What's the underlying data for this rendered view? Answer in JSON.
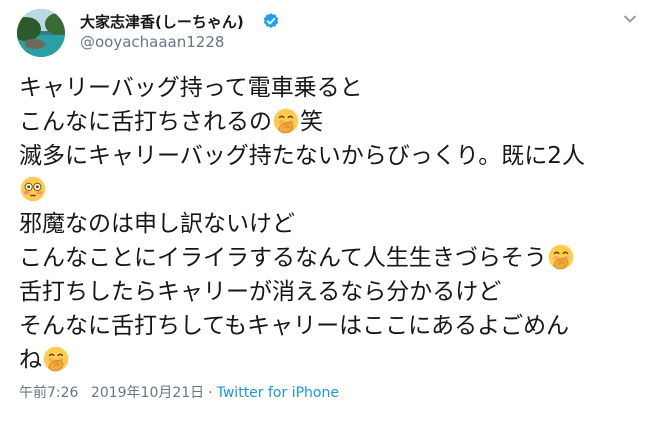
{
  "user": {
    "display_name": "大家志津香(しーちゃん)",
    "handle": "@ooyachaaan1228"
  },
  "tweet": {
    "lines": [
      [
        "キャリーバッグ持って電車乗ると"
      ],
      [
        "こんなに舌打ちされるの",
        "#hand-over-mouth",
        "笑"
      ],
      [
        "滅多にキャリーバッグ持たないからびっくり。既に2人"
      ],
      [
        "#flushed"
      ],
      [
        "邪魔なのは申し訳ないけど"
      ],
      [
        "こんなことにイライラするなんて人生生きづらそう",
        "#hand-over-mouth"
      ],
      [
        "舌打ちしたらキャリーが消えるなら分かるけど"
      ],
      [
        "そんなに舌打ちしてもキャリーはここにあるよごめん"
      ],
      [
        "ね",
        "#hand-over-mouth"
      ]
    ],
    "emoji_icons": [
      "hand-over-mouth-emoji",
      "flushed-face-emoji"
    ]
  },
  "meta": {
    "time": "午前7:26",
    "separator": "·",
    "date": "2019年10月21日",
    "source": "Twitter for iPhone"
  },
  "colors": {
    "text": "#14171a",
    "secondary": "#657786",
    "link": "#1b95e0",
    "verified": "#1da1f2"
  }
}
